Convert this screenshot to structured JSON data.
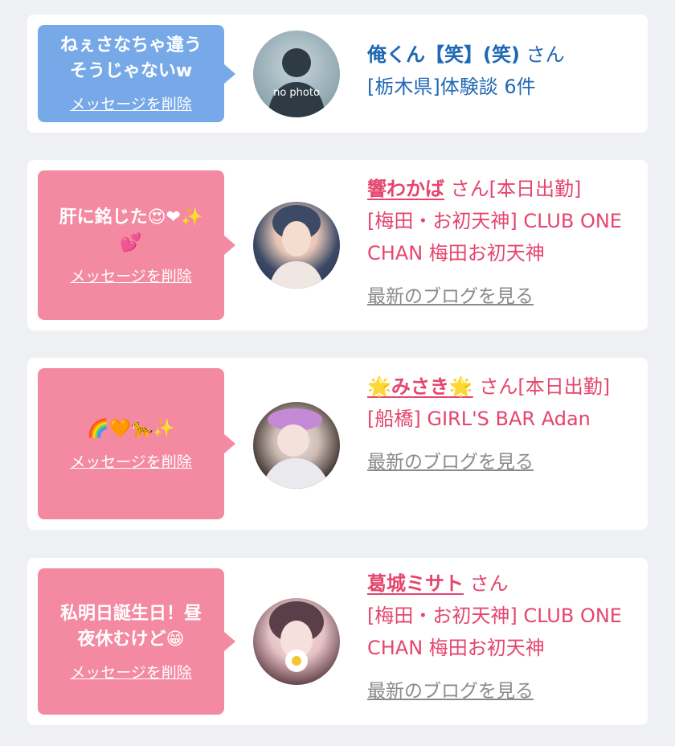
{
  "colors": {
    "bubble_blue": "#77a9e8",
    "bubble_pink": "#f48aa2",
    "name_pink": "#e5456e",
    "name_blue": "#1f68b4",
    "muted": "#8a8a8a"
  },
  "cards": [
    {
      "message_line1": "ねぇさなちゃ違う",
      "message_line2": "そうじゃないw",
      "delete_label": "メッセージを削除",
      "avatar_text": "no photo",
      "name": "俺くん【笑】(笑)",
      "honorific": " さん",
      "detail": "[栃木県]体験談 6件"
    },
    {
      "message_line1": "肝に銘じた😍❤✨",
      "message_line2": "💕",
      "delete_label": "メッセージを削除",
      "name": "響わかば",
      "honorific": " さん",
      "status": "[本日出勤]",
      "shop": "[梅田・お初天神] CLUB ONE CHAN 梅田お初天神",
      "blog_label": "最新のブログを見る"
    },
    {
      "message_line1": "🌈🧡🐆✨",
      "delete_label": "メッセージを削除",
      "name": "🌟みさき🌟",
      "honorific": " さん",
      "status": "[本日出勤]",
      "shop": "[船橋] GIRL'S BAR Adan",
      "blog_label": "最新のブログを見る"
    },
    {
      "message_line1": "私明日誕生日！昼",
      "message_line2": "夜休むけど😁",
      "delete_label": "メッセージを削除",
      "name": "葛城ミサト",
      "honorific": " さん",
      "shop": "[梅田・お初天神] CLUB ONE CHAN 梅田お初天神",
      "blog_label": "最新のブログを見る"
    }
  ]
}
